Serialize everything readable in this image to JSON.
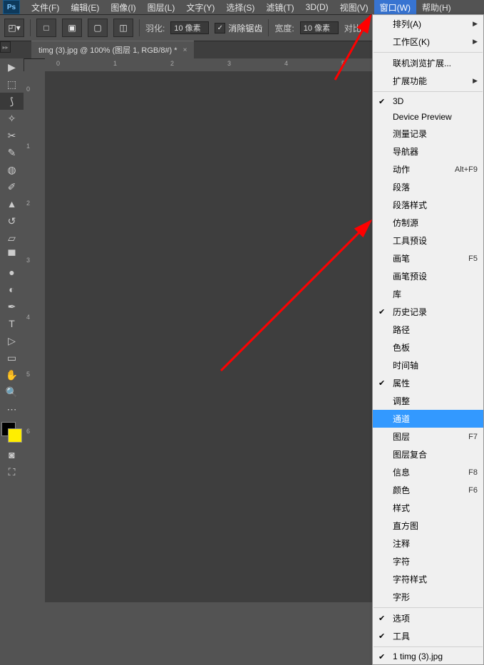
{
  "app": {
    "logo": "Ps"
  },
  "menu": {
    "file": "文件(F)",
    "edit": "编辑(E)",
    "image": "图像(I)",
    "layer": "图层(L)",
    "type": "文字(Y)",
    "select": "选择(S)",
    "filter": "滤镜(T)",
    "threed": "3D(D)",
    "view": "视图(V)",
    "window": "窗口(W)",
    "help": "帮助(H)"
  },
  "options": {
    "feather_label": "羽化:",
    "feather_value": "10 像素",
    "antialiasing": "消除锯齿",
    "width_label": "宽度:",
    "width_value": "10 像素",
    "contrast_label": "对比"
  },
  "tab": {
    "title": "timg (3).jpg @ 100% (图层 1, RGB/8#) *",
    "close": "×"
  },
  "ruler_h": {
    "n0": "0",
    "n1": "1",
    "n2": "2",
    "n3": "3",
    "n4": "4",
    "n5": "5"
  },
  "ruler_v": {
    "n0": "0",
    "n1": "1",
    "n2": "2",
    "n3": "3",
    "n4": "4",
    "n5": "5",
    "n6": "6"
  },
  "dropdown": {
    "arrange": "排列(A)",
    "workspace": "工作区(K)",
    "browse_ext": "联机浏览扩展...",
    "extensions": "扩展功能",
    "threed": "3D",
    "device_preview": "Device Preview",
    "measure_log": "测量记录",
    "navigator": "导航器",
    "actions": "动作",
    "actions_sc": "Alt+F9",
    "paragraph": "段落",
    "para_styles": "段落样式",
    "clone_source": "仿制源",
    "tool_presets": "工具预设",
    "brush": "画笔",
    "brush_sc": "F5",
    "brush_presets": "画笔预设",
    "libraries": "库",
    "history": "历史记录",
    "paths": "路径",
    "swatches": "色板",
    "timeline": "时间轴",
    "properties": "属性",
    "adjustments": "调整",
    "channels": "通道",
    "layers": "图层",
    "layers_sc": "F7",
    "layer_comps": "图层复合",
    "info": "信息",
    "info_sc": "F8",
    "color": "颜色",
    "color_sc": "F6",
    "styles": "样式",
    "histogram": "直方图",
    "notes": "注释",
    "character": "字符",
    "char_styles": "字符样式",
    "glyphs": "字形",
    "options_panel": "选项",
    "tools_panel": "工具",
    "doc1": "1 timg (3).jpg"
  }
}
